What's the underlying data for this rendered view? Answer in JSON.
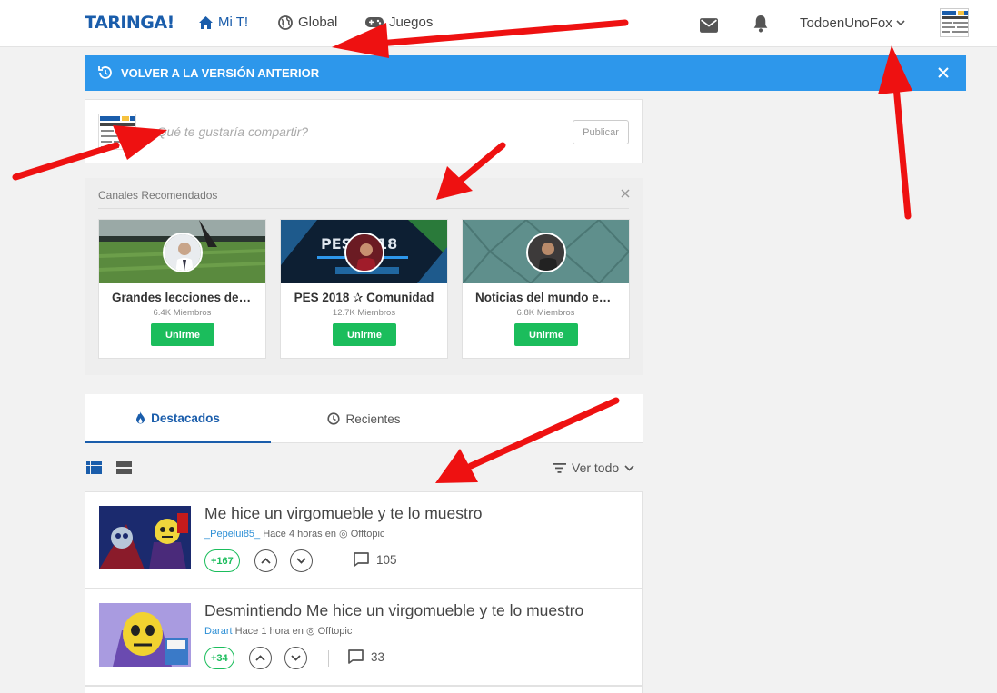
{
  "header": {
    "logo": "TARINGA!",
    "nav": [
      {
        "label": "Mi T!",
        "icon": "home-icon",
        "active": true
      },
      {
        "label": "Global",
        "icon": "globe-icon",
        "active": false
      },
      {
        "label": "Juegos",
        "icon": "gamepad-icon",
        "active": false
      }
    ],
    "username": "TodoenUnoFox"
  },
  "banner": {
    "label": "VOLVER A LA VERSIÓN ANTERIOR",
    "color": "#2d97eb"
  },
  "composer": {
    "placeholder": "¿Qué te gustaría compartir?",
    "publish_label": "Publicar"
  },
  "channels": {
    "title": "Canales Recomendados",
    "items": [
      {
        "name": "Grandes lecciones del fútbol",
        "members": "6.4K Miembros",
        "join_label": "Unirme"
      },
      {
        "name": "PES 2018 ✰ Comunidad",
        "members": "12.7K Miembros",
        "join_label": "Unirme"
      },
      {
        "name": "Noticias del mundo en general",
        "members": "6.8K Miembros",
        "join_label": "Unirme"
      }
    ]
  },
  "tabs": [
    {
      "label": "Destacados",
      "icon": "fire-icon",
      "active": true
    },
    {
      "label": "Recientes",
      "icon": "clock-icon",
      "active": false
    }
  ],
  "filter": {
    "label": "Ver todo"
  },
  "posts": [
    {
      "title": "Me hice un virgomueble y te lo muestro",
      "author": "_Pepelui85_",
      "time": "Hace 4 horas",
      "in": "en",
      "community": "Offtopic",
      "score": "+167",
      "comments": "105"
    },
    {
      "title": "Desmintiendo Me hice un virgomueble y te lo muestro",
      "author": "Darart",
      "time": "Hace 1 hora",
      "in": "en",
      "community": "Offtopic",
      "score": "+34",
      "comments": "33"
    }
  ],
  "colors": {
    "accent": "#1a5dab",
    "green": "#1bbd5c",
    "arrow": "#ee1111"
  }
}
